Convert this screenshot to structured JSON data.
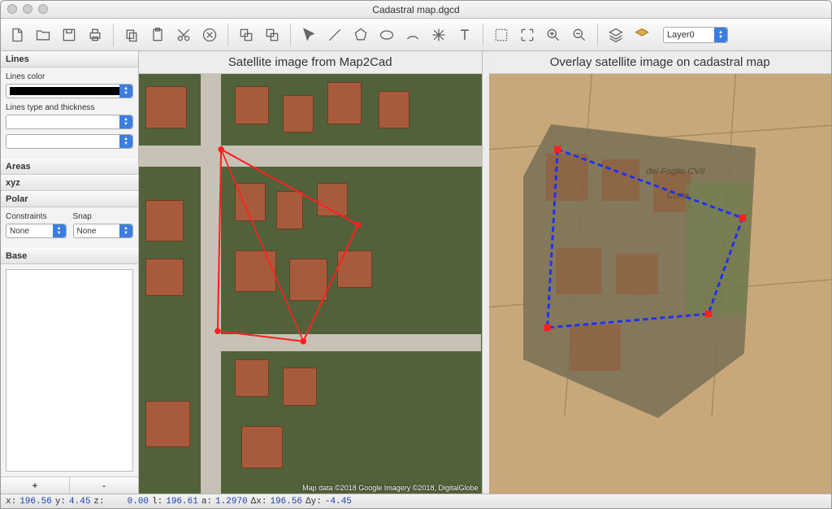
{
  "title": "Cadastral map.dgcd",
  "layer": "Layer0",
  "sidebar": {
    "lines": {
      "hdr": "Lines",
      "color_label": "Lines color",
      "type_label": "Lines type and thickness"
    },
    "areas": "Areas",
    "xyz": "xyz",
    "polar": "Polar",
    "constraints_label": "Constraints",
    "snap_label": "Snap",
    "constraints_value": "None",
    "snap_value": "None",
    "base": "Base",
    "plus": "+",
    "minus": "-"
  },
  "views": {
    "left_header": "Satellite image from Map2Cad",
    "right_header": "Overlay satellite image on cadastral map",
    "attribution": "Map data ©2018 Google  Imagery ©2018,  DigitalGlobe"
  },
  "parchment": {
    "t1": "del Foglio CVII",
    "t2": "Corte"
  },
  "statusbar": {
    "x_lbl": "x:",
    "x": "196.56",
    "y_lbl": "y:",
    "y": "4.45",
    "z_lbl": "z:",
    "l1": "0.00",
    "lb1": "l:",
    "l2": "196.61",
    "ab": "a:",
    "a": "1.2970",
    "dx_lbl": "Δx:",
    "dx": "196.56",
    "dy_lbl": "Δy:",
    "dy": "-4.45"
  }
}
